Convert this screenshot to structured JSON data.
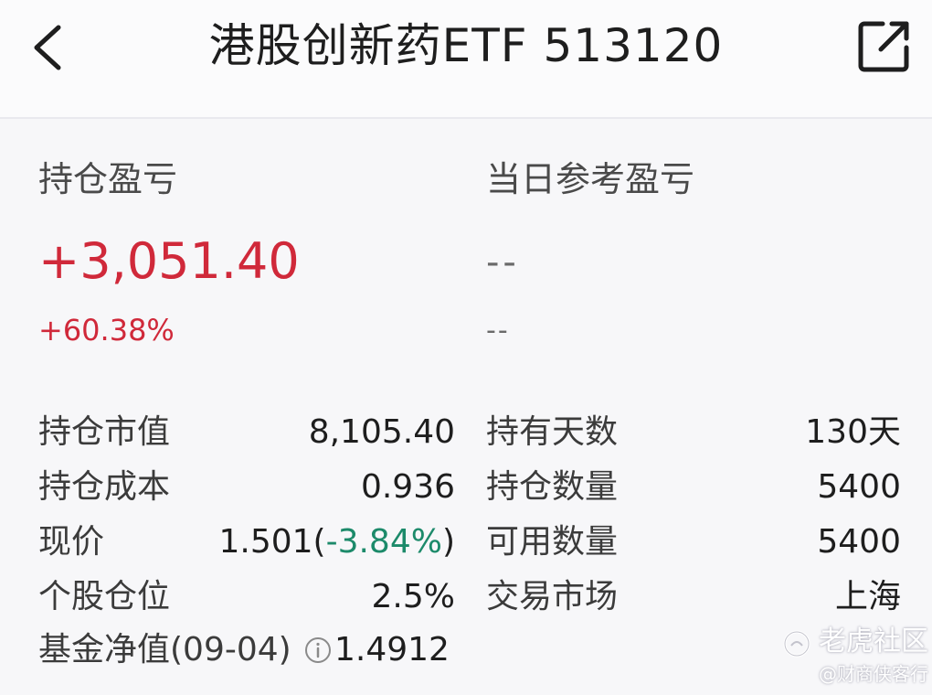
{
  "header": {
    "title": "港股创新药ETF 513120",
    "back_icon": "chevron-left-icon",
    "share_icon": "share-external-icon"
  },
  "pnl": {
    "position_label": "持仓盈亏",
    "position_value": "+3,051.40",
    "position_pct": "+60.38%",
    "daily_label": "当日参考盈亏",
    "daily_value": "--",
    "daily_pct": "--"
  },
  "details": {
    "left": [
      {
        "label": "持仓市值",
        "value": "8,105.40"
      },
      {
        "label": "持仓成本",
        "value": "0.936"
      },
      {
        "label": "现价",
        "value_main": "1.501(",
        "value_change": "-3.84%",
        "value_close": ")"
      },
      {
        "label": "个股仓位",
        "value": "2.5%"
      },
      {
        "label": "基金净值(09-04)",
        "value": "1.4912"
      }
    ],
    "right": [
      {
        "label": "持有天数",
        "value": "130天"
      },
      {
        "label": "持仓数量",
        "value": "5400"
      },
      {
        "label": "可用数量",
        "value": "5400"
      },
      {
        "label": "交易市场",
        "value": "上海"
      }
    ]
  },
  "watermark": {
    "brand": "老虎社区",
    "author": "@财商侠客行"
  },
  "colors": {
    "gain": "#d0293a",
    "loss": "#1c8a6a"
  }
}
